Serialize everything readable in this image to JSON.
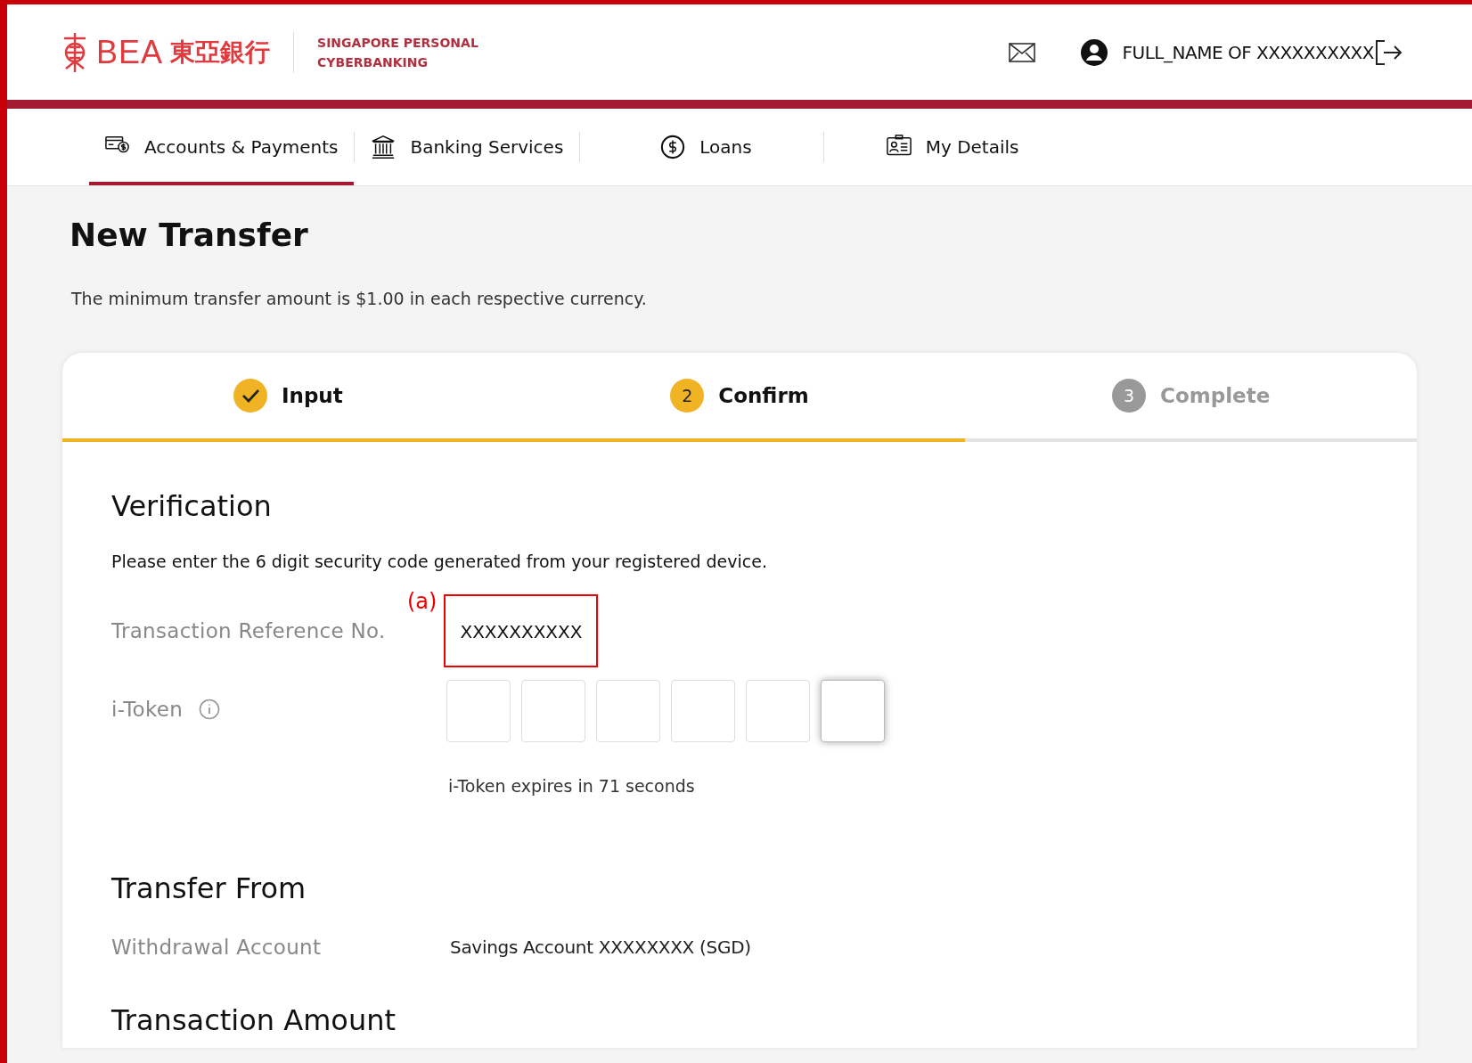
{
  "header": {
    "brand": "BEA",
    "brand_cjk": "東亞銀行",
    "site_name": [
      "SINGAPORE PERSONAL",
      "CYBERBANKING"
    ],
    "user_name": "FULL_NAME OF XXXXXXXXXX"
  },
  "nav": [
    {
      "label": "Accounts & Payments",
      "selected": true
    },
    {
      "label": "Banking Services",
      "selected": false
    },
    {
      "label": "Loans",
      "selected": false
    },
    {
      "label": "My Details",
      "selected": false
    }
  ],
  "page_title": "New Transfer",
  "notice": "The minimum transfer amount is $1.00 in each respective currency.",
  "steps": [
    {
      "label": "Input",
      "kind": "done"
    },
    {
      "label": "Confirm",
      "number": "2",
      "kind": "current"
    },
    {
      "label": "Complete",
      "number": "3",
      "kind": "pending"
    }
  ],
  "verification": {
    "title": "Verification",
    "instruction": "Please enter the 6 digit security code generated from your registered device.",
    "reference_label": "Transaction Reference No.",
    "reference_value": "XXXXXXXXXX",
    "annotation": "(a)",
    "itoken_label": "i-Token",
    "itoken_digits": [
      {
        "focused": false
      },
      {
        "focused": false
      },
      {
        "focused": false
      },
      {
        "focused": false
      },
      {
        "focused": false
      },
      {
        "focused": true
      }
    ],
    "expiry": "i-Token expires in 71 seconds"
  },
  "transfer_from": {
    "title": "Transfer From",
    "label": "Withdrawal Account",
    "value": "Savings Account XXXXXXXX (SGD)"
  },
  "transaction_amount": {
    "title": "Transaction Amount"
  }
}
